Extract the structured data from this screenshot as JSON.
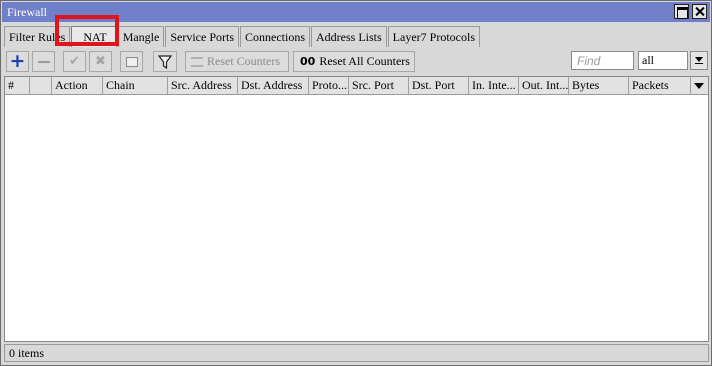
{
  "window": {
    "title": "Firewall"
  },
  "tabs": [
    {
      "label": "Filter Rules"
    },
    {
      "label": "NAT",
      "active": true
    },
    {
      "label": "Mangle"
    },
    {
      "label": "Service Ports"
    },
    {
      "label": "Connections"
    },
    {
      "label": "Address Lists"
    },
    {
      "label": "Layer7 Protocols"
    }
  ],
  "toolbar": {
    "add_icon": "plus-icon",
    "remove_icon": "minus-icon",
    "enable_icon": "check-icon",
    "disable_icon": "x-icon",
    "comment_icon": "note-icon",
    "filter_icon": "funnel-icon",
    "reset_counters_label": "Reset Counters",
    "reset_all_counters_prefix": "00",
    "reset_all_counters_label": "Reset All Counters",
    "find_placeholder": "Find",
    "filter_select_value": "all"
  },
  "table": {
    "columns": [
      "#",
      "",
      "Action",
      "Chain",
      "Src. Address",
      "Dst. Address",
      "Proto...",
      "Src. Port",
      "Dst. Port",
      "In. Inte...",
      "Out. Int...",
      "Bytes",
      "Packets"
    ],
    "rows": []
  },
  "status": {
    "text": "0 items"
  },
  "colors": {
    "titlebar": "#6f7fc8",
    "highlight": "#e0141c",
    "add_icon": "#1f3fb5"
  }
}
